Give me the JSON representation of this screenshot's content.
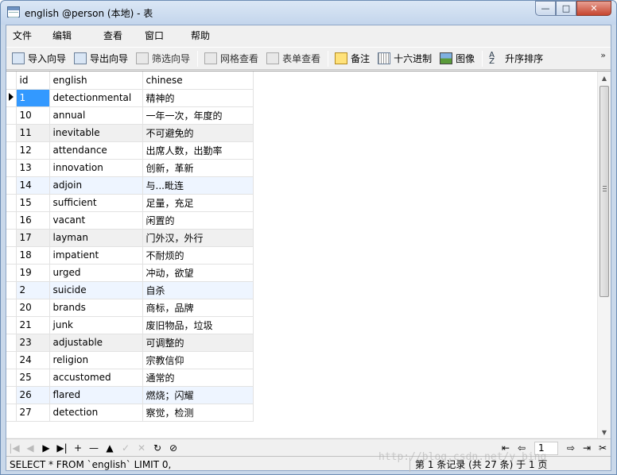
{
  "window": {
    "title": "english @person (本地) - 表",
    "controls": {
      "minimize": "—",
      "maximize": "□",
      "close": "✕"
    }
  },
  "menu": [
    "文件",
    "编辑",
    "查看",
    "窗口",
    "帮助"
  ],
  "toolbar": {
    "buttons": [
      {
        "label": "导入向导",
        "icon": "import-icon",
        "enabled": true
      },
      {
        "label": "导出向导",
        "icon": "export-icon",
        "enabled": true
      },
      {
        "label": "筛选向导",
        "icon": "filter-icon",
        "enabled": false
      },
      {
        "label": "网格查看",
        "icon": "grid-view-icon",
        "enabled": false
      },
      {
        "label": "表单查看",
        "icon": "form-view-icon",
        "enabled": false
      },
      {
        "label": "备注",
        "icon": "note-icon",
        "enabled": true
      },
      {
        "label": "十六进制",
        "icon": "hex-icon",
        "enabled": true
      },
      {
        "label": "图像",
        "icon": "image-icon",
        "enabled": true
      },
      {
        "label": "升序排序",
        "icon": "sort-asc-icon",
        "enabled": true
      }
    ],
    "more": "»"
  },
  "grid": {
    "columns": [
      "id",
      "english",
      "chinese"
    ],
    "rows": [
      [
        "1",
        "detectionmental",
        "精神的"
      ],
      [
        "10",
        "annual",
        "一年一次，年度的"
      ],
      [
        "11",
        "inevitable",
        "不可避免的"
      ],
      [
        "12",
        "attendance",
        "出席人数，出勤率"
      ],
      [
        "13",
        "innovation",
        "创新，革新"
      ],
      [
        "14",
        "adjoin",
        "与...毗连"
      ],
      [
        "15",
        "sufficient",
        "足量，充足"
      ],
      [
        "16",
        "vacant",
        "闲置的"
      ],
      [
        "17",
        "layman",
        "门外汉，外行"
      ],
      [
        "18",
        "impatient",
        "不耐烦的"
      ],
      [
        "19",
        "urged",
        "冲动，欲望"
      ],
      [
        "2",
        "suicide",
        "自杀"
      ],
      [
        "20",
        "brands",
        "商标，品牌"
      ],
      [
        "21",
        "junk",
        "废旧物品，垃圾"
      ],
      [
        "23",
        "adjustable",
        "可调整的"
      ],
      [
        "24",
        "religion",
        "宗教信仰"
      ],
      [
        "25",
        "accustomed",
        "通常的"
      ],
      [
        "26",
        "flared",
        "燃烧；闪耀"
      ],
      [
        "27",
        "detection",
        "察觉，检测"
      ]
    ],
    "current_row": 0
  },
  "navigation": {
    "buttons": [
      "|◀",
      "◀",
      "▶",
      "▶|",
      "+",
      "—",
      "▲",
      "✓",
      "✕",
      "↻",
      "⊘"
    ],
    "page": "1"
  },
  "status": {
    "sql": "SELECT * FROM `english` LIMIT 0,",
    "page_info": "第 1 条记录 (共 27 条) 于 1 页"
  },
  "watermark": "http://blog.csdn.net/y_bing",
  "colors": {
    "selection": "#3399ff",
    "alt_row": "#f0f0f0",
    "accent_row": "#eef5ff"
  }
}
